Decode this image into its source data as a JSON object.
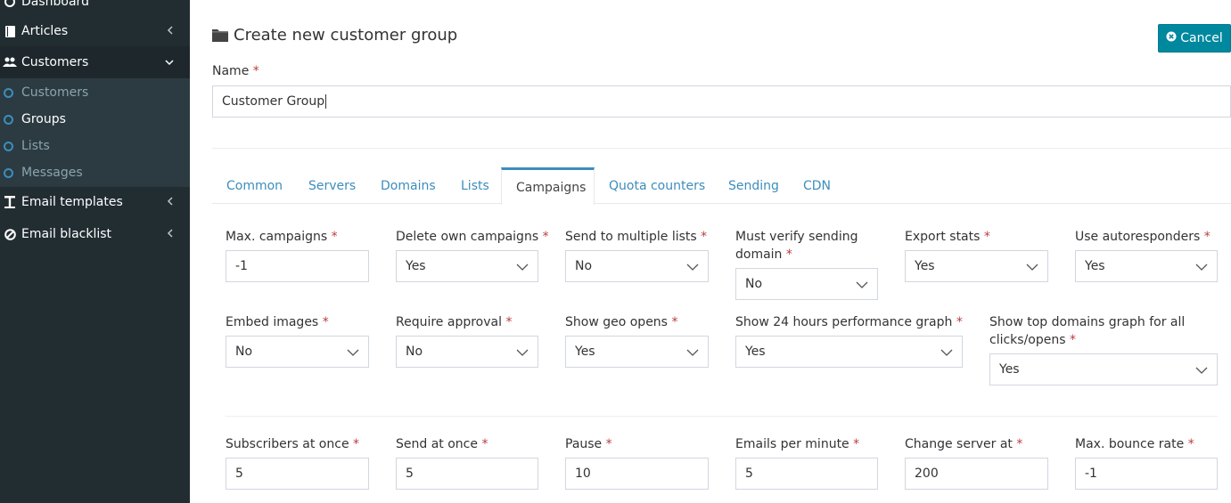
{
  "sidebar": {
    "items": [
      {
        "label": "Dashboard",
        "icon": "dashboard-icon"
      },
      {
        "label": "Articles",
        "icon": "book-icon"
      },
      {
        "label": "Customers",
        "icon": "users-icon"
      },
      {
        "label": "Email templates",
        "icon": "text-icon"
      },
      {
        "label": "Email blacklist",
        "icon": "ban-icon"
      }
    ],
    "subitems": [
      {
        "label": "Customers"
      },
      {
        "label": "Groups"
      },
      {
        "label": "Lists"
      },
      {
        "label": "Messages"
      }
    ]
  },
  "header": {
    "title": "Create new customer group",
    "cancel_label": "Cancel"
  },
  "name_field": {
    "label": "Name",
    "required": "*",
    "value": "Customer Group"
  },
  "tabs": [
    "Common",
    "Servers",
    "Domains",
    "Lists",
    "Campaigns",
    "Quota counters",
    "Sending",
    "CDN"
  ],
  "fields_row1": [
    {
      "label": "Max. campaigns",
      "value": "-1",
      "type": "input"
    },
    {
      "label": "Delete own campaigns",
      "value": "Yes",
      "type": "select"
    },
    {
      "label": "Send to multiple lists",
      "value": "No",
      "type": "select"
    },
    {
      "label": "Must verify sending",
      "label2": "domain",
      "value": "No",
      "type": "select"
    },
    {
      "label": "Export stats",
      "value": "Yes",
      "type": "select"
    },
    {
      "label": "Use autoresponders",
      "value": "Yes",
      "type": "select"
    }
  ],
  "fields_row2": [
    {
      "label": "Embed images",
      "value": "No",
      "type": "select"
    },
    {
      "label": "Require approval",
      "value": "No",
      "type": "select"
    },
    {
      "label": "Show geo opens",
      "value": "Yes",
      "type": "select"
    },
    {
      "label": "Show 24 hours performance graph",
      "value": "Yes",
      "type": "select"
    },
    {
      "label": "Show top domains graph for all",
      "label2": "clicks/opens",
      "value": "Yes",
      "type": "select"
    }
  ],
  "fields_row3": [
    {
      "label": "Subscribers at once",
      "value": "5"
    },
    {
      "label": "Send at once",
      "value": "5"
    },
    {
      "label": "Pause",
      "value": "10"
    },
    {
      "label": "Emails per minute",
      "value": "5"
    },
    {
      "label": "Change server at",
      "value": "200"
    },
    {
      "label": "Max. bounce rate",
      "value": "-1"
    }
  ]
}
